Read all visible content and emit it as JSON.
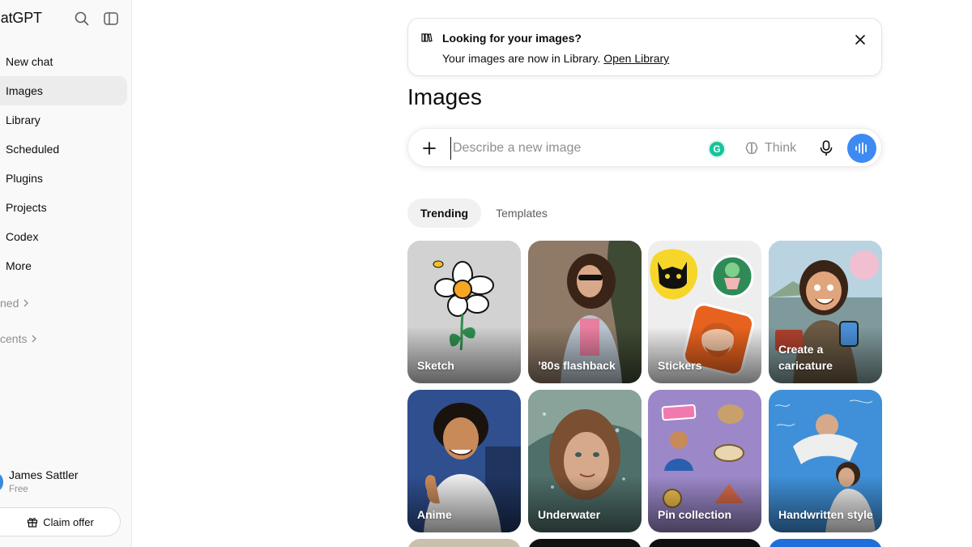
{
  "app": {
    "title": "hatGPT"
  },
  "sidebar": {
    "items": [
      {
        "label": "New chat",
        "name": "new-chat"
      },
      {
        "label": "Images",
        "name": "images",
        "active": true
      },
      {
        "label": "Library",
        "name": "library"
      },
      {
        "label": "Scheduled",
        "name": "scheduled"
      },
      {
        "label": "Plugins",
        "name": "plugins"
      },
      {
        "label": "Projects",
        "name": "projects"
      },
      {
        "label": "Codex",
        "name": "codex"
      },
      {
        "label": "More",
        "name": "more"
      }
    ],
    "pinned_label": "Pinned",
    "recents_label": "Recents",
    "pinned_visible": "ned",
    "recents_visible": "cents",
    "user": {
      "name": "James Sattler",
      "plan": "Free"
    },
    "claim_offer": "Claim offer"
  },
  "banner": {
    "title": "Looking for your images?",
    "text": "Your images are now in Library.",
    "link": "Open Library"
  },
  "page": {
    "title": "Images"
  },
  "composer": {
    "placeholder": "Describe a new image",
    "think_label": "Think",
    "grammarly_letter": "G"
  },
  "tabs": [
    {
      "label": "Trending",
      "active": true
    },
    {
      "label": "Templates",
      "active": false
    }
  ],
  "styles": [
    {
      "label": "Sketch",
      "bg": "#cfcfcf"
    },
    {
      "label": "’80s flashback",
      "bg": "#8a7462"
    },
    {
      "label": "Stickers",
      "bg": "#ececec"
    },
    {
      "label": "Create a caricature",
      "bg": "#6f8a8a"
    },
    {
      "label": "Anime",
      "bg": "#2f4f8f"
    },
    {
      "label": "Underwater",
      "bg": "#5f7d78"
    },
    {
      "label": "Pin collection",
      "bg": "#9a86c8"
    },
    {
      "label": "Handwritten style",
      "bg": "#3f8fd8"
    }
  ],
  "colors": {
    "accent": "#3d8bf2",
    "active_nav": "#ececec",
    "sidebar_bg": "#f9f9f9"
  }
}
